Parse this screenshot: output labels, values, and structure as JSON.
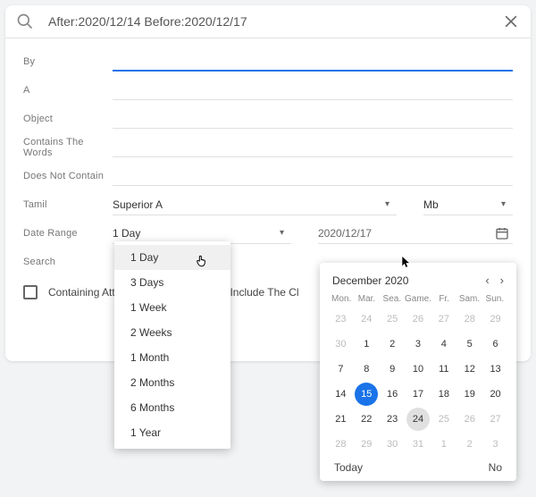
{
  "search": {
    "query": "After:2020/12/14 Before:2020/12/17"
  },
  "form": {
    "by_label": "By",
    "a_label": "A",
    "object_label": "Object",
    "contains_label": "Contains The Words",
    "not_contain_label": "Does Not Contain",
    "tamil_label": "Tamil",
    "tamil_value": "Superior A",
    "unit_value": "Mb",
    "date_range_label": "Date Range",
    "date_range_value": "1 Day",
    "date_value": "2020/12/17",
    "search_label": "Search",
    "checkbox_label": "Containing Attachments Falling-Down Include The Cl"
  },
  "dropdown": {
    "items": [
      "1 Day",
      "3 Days",
      "1 Week",
      "2 Weeks",
      "1 Month",
      "2 Months",
      "6 Months",
      "1 Year"
    ]
  },
  "calendar": {
    "title": "December 2020",
    "dow": [
      "Mon.",
      "Mar.",
      "Sea.",
      "Game.",
      "Fr.",
      "Sam.",
      "Sun."
    ],
    "days": [
      {
        "n": 23,
        "outside": true
      },
      {
        "n": 24,
        "outside": true
      },
      {
        "n": 25,
        "outside": true
      },
      {
        "n": 26,
        "outside": true
      },
      {
        "n": 27,
        "outside": true
      },
      {
        "n": 28,
        "outside": true
      },
      {
        "n": 29,
        "outside": true
      },
      {
        "n": 30,
        "outside": true
      },
      {
        "n": 1
      },
      {
        "n": 2
      },
      {
        "n": 3
      },
      {
        "n": 4
      },
      {
        "n": 5
      },
      {
        "n": 6
      },
      {
        "n": 7
      },
      {
        "n": 8
      },
      {
        "n": 9
      },
      {
        "n": 10
      },
      {
        "n": 11
      },
      {
        "n": 12
      },
      {
        "n": 13
      },
      {
        "n": 14
      },
      {
        "n": 15,
        "selected": true
      },
      {
        "n": 16
      },
      {
        "n": 17
      },
      {
        "n": 18
      },
      {
        "n": 19
      },
      {
        "n": 20
      },
      {
        "n": 21
      },
      {
        "n": 22
      },
      {
        "n": 23
      },
      {
        "n": 24,
        "hov": true
      },
      {
        "n": 25,
        "outside": true
      },
      {
        "n": 26,
        "outside": true
      },
      {
        "n": 27,
        "outside": true
      },
      {
        "n": 28,
        "outside": true
      },
      {
        "n": 29,
        "outside": true
      },
      {
        "n": 30,
        "outside": true
      },
      {
        "n": 31,
        "outside": true
      },
      {
        "n": 1,
        "outside": true
      },
      {
        "n": 2,
        "outside": true
      },
      {
        "n": 3,
        "outside": true
      }
    ],
    "today_label": "Today",
    "no_label": "No"
  }
}
